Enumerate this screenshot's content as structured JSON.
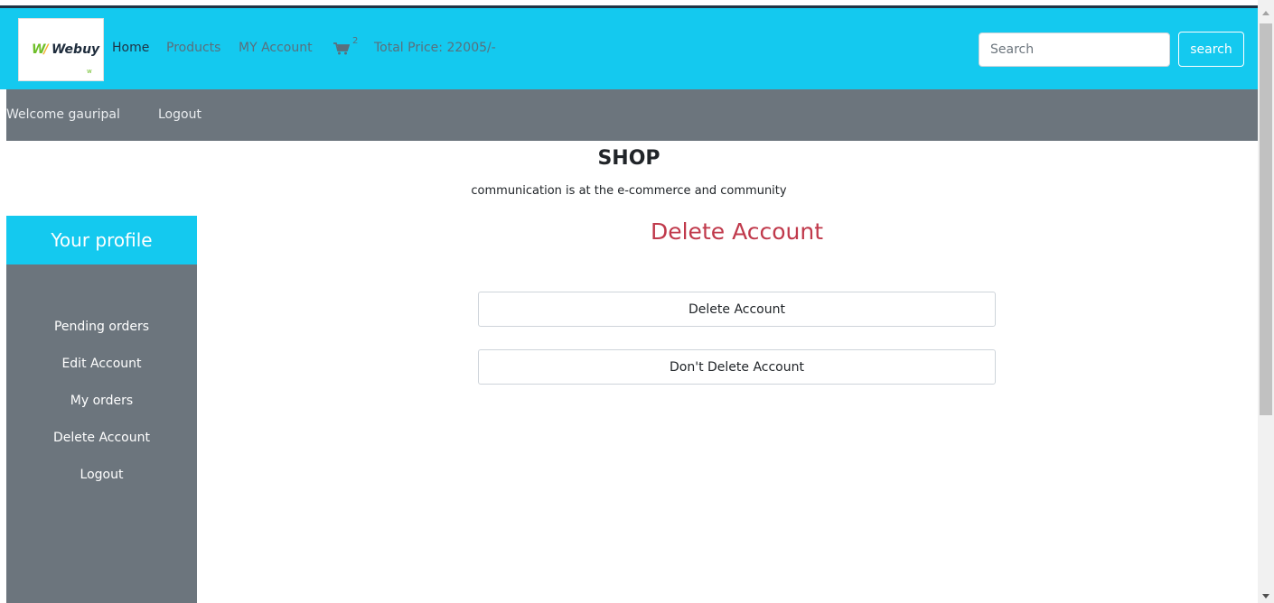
{
  "brand": {
    "logo_text": "Webuy",
    "logo_mark": "W"
  },
  "nav": {
    "home": "Home",
    "products": "Products",
    "my_account": "MY Account",
    "cart_icon": "cart-icon",
    "cart_count": "2",
    "total_price": "Total Price: 22005/-"
  },
  "search": {
    "placeholder": "Search",
    "button_label": "search"
  },
  "subbar": {
    "welcome": "Welcome gauripal",
    "logout": "Logout"
  },
  "shop": {
    "title": "SHOP",
    "subtitle": "communication is at the e-commerce and community"
  },
  "sidebar": {
    "header": "Your profile",
    "items": [
      {
        "label": "Pending orders"
      },
      {
        "label": "Edit Account"
      },
      {
        "label": "My orders"
      },
      {
        "label": "Delete Account"
      },
      {
        "label": "Logout"
      }
    ]
  },
  "main": {
    "heading": "Delete Account",
    "delete_button": "Delete Account",
    "keep_button": "Don't Delete Account"
  },
  "colors": {
    "primary": "#14c9ef",
    "secondary": "#6c757d",
    "danger": "#c0394b"
  }
}
